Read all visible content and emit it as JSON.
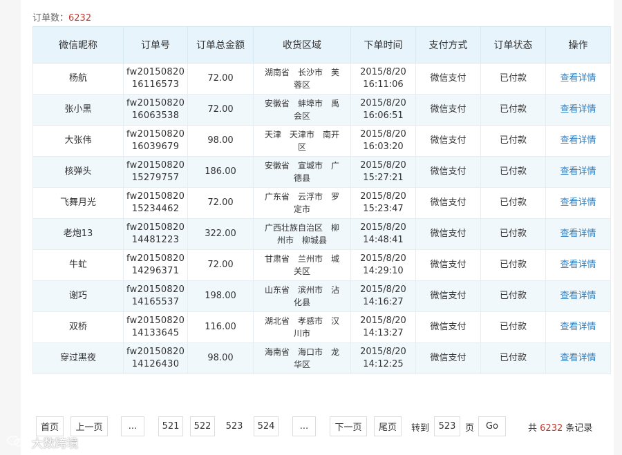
{
  "summary": {
    "label": "订单数：",
    "count": "6232"
  },
  "table": {
    "headers": [
      "微信昵称",
      "订单号",
      "订单总金额",
      "收货区域",
      "下单时间",
      "支付方式",
      "订单状态",
      "操作"
    ],
    "rows": [
      {
        "nickname": "杨航",
        "order_no_1": "fw20150820",
        "order_no_2": "16116573",
        "amount": "72.00",
        "region_1": "湖南省　长沙市　芙",
        "region_2": "蓉区",
        "date": "2015/8/20",
        "time": "16:11:06",
        "payment": "微信支付",
        "status": "已付款",
        "action": "查看详情"
      },
      {
        "nickname": "张小黑",
        "order_no_1": "fw20150820",
        "order_no_2": "16063538",
        "amount": "72.00",
        "region_1": "安徽省　蚌埠市　禹",
        "region_2": "会区",
        "date": "2015/8/20",
        "time": "16:06:51",
        "payment": "微信支付",
        "status": "已付款",
        "action": "查看详情"
      },
      {
        "nickname": "大张伟",
        "order_no_1": "fw20150820",
        "order_no_2": "16039679",
        "amount": "98.00",
        "region_1": "天津　天津市　南开",
        "region_2": "区",
        "date": "2015/8/20",
        "time": "16:03:20",
        "payment": "微信支付",
        "status": "已付款",
        "action": "查看详情"
      },
      {
        "nickname": "核弹头",
        "order_no_1": "fw20150820",
        "order_no_2": "15279757",
        "amount": "186.00",
        "region_1": "安徽省　宣城市　广",
        "region_2": "德县",
        "date": "2015/8/20",
        "time": "15:27:21",
        "payment": "微信支付",
        "status": "已付款",
        "action": "查看详情"
      },
      {
        "nickname": "飞舞月光",
        "order_no_1": "fw20150820",
        "order_no_2": "15234462",
        "amount": "72.00",
        "region_1": "广东省　云浮市　罗",
        "region_2": "定市",
        "date": "2015/8/20",
        "time": "15:23:47",
        "payment": "微信支付",
        "status": "已付款",
        "action": "查看详情"
      },
      {
        "nickname": "老炮13",
        "order_no_1": "fw20150820",
        "order_no_2": "14481223",
        "amount": "322.00",
        "region_1": "广西壮族自治区　柳",
        "region_2": "州市　柳城县",
        "date": "2015/8/20",
        "time": "14:48:41",
        "payment": "微信支付",
        "status": "已付款",
        "action": "查看详情"
      },
      {
        "nickname": "牛虻",
        "order_no_1": "fw20150820",
        "order_no_2": "14296371",
        "amount": "72.00",
        "region_1": "甘肃省　兰州市　城",
        "region_2": "关区",
        "date": "2015/8/20",
        "time": "14:29:10",
        "payment": "微信支付",
        "status": "已付款",
        "action": "查看详情"
      },
      {
        "nickname": "谢巧",
        "order_no_1": "fw20150820",
        "order_no_2": "14165537",
        "amount": "198.00",
        "region_1": "山东省　滨州市　沾",
        "region_2": "化县",
        "date": "2015/8/20",
        "time": "14:16:27",
        "payment": "微信支付",
        "status": "已付款",
        "action": "查看详情"
      },
      {
        "nickname": "双桥",
        "order_no_1": "fw20150820",
        "order_no_2": "14133645",
        "amount": "116.00",
        "region_1": "湖北省　孝感市　汉",
        "region_2": "川市",
        "date": "2015/8/20",
        "time": "14:13:27",
        "payment": "微信支付",
        "status": "已付款",
        "action": "查看详情"
      },
      {
        "nickname": "穿过黑夜",
        "order_no_1": "fw20150820",
        "order_no_2": "14126430",
        "amount": "98.00",
        "region_1": "海南省　海口市　龙",
        "region_2": "华区",
        "date": "2015/8/20",
        "time": "14:12:25",
        "payment": "微信支付",
        "status": "已付款",
        "action": "查看详情"
      }
    ]
  },
  "pager": {
    "first": "首页",
    "prev": "上一页",
    "ellipsis_left": "...",
    "pages": [
      "521",
      "522",
      "523",
      "524"
    ],
    "current": "523",
    "ellipsis_right": "...",
    "next": "下一页",
    "last": "尾页",
    "goto_label": "转到",
    "goto_value": "523",
    "page_unit": "页",
    "go": "Go",
    "total_prefix": "共",
    "total_count": "6232",
    "total_suffix": "条记录"
  },
  "watermark": {
    "icon": "chat-bubble-icon",
    "text": "大数跨境"
  },
  "colors": {
    "header_bg": "#e8f4fb",
    "row_alt_bg": "#f1f8fc",
    "link": "#2c7fc4",
    "count_red": "#c0392b"
  }
}
